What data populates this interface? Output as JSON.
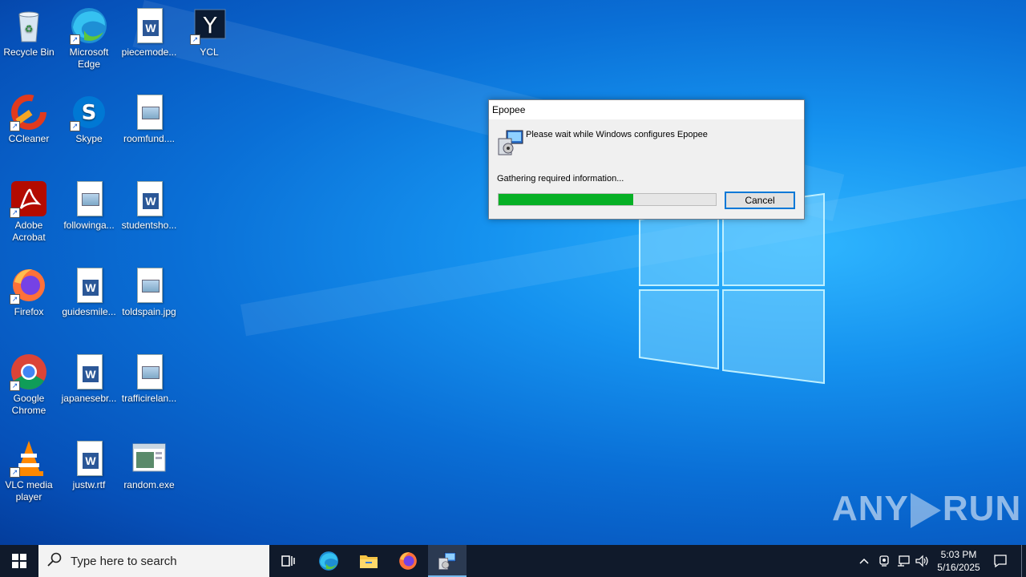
{
  "desktop": {
    "icons": [
      {
        "label": "Recycle Bin",
        "icon": "recycle-bin-icon"
      },
      {
        "label": "Microsoft Edge",
        "icon": "edge-icon"
      },
      {
        "label": "piecemode...",
        "icon": "word-doc-icon"
      },
      {
        "label": "YCL",
        "icon": "ycl-icon"
      },
      {
        "label": "CCleaner",
        "icon": "ccleaner-icon"
      },
      {
        "label": "Skype",
        "icon": "skype-icon"
      },
      {
        "label": "roomfund....",
        "icon": "image-file-icon"
      },
      {
        "label": "Adobe Acrobat",
        "icon": "acrobat-icon"
      },
      {
        "label": "followinga...",
        "icon": "image-file-icon"
      },
      {
        "label": "studentsho...",
        "icon": "word-doc-icon"
      },
      {
        "label": "Firefox",
        "icon": "firefox-icon"
      },
      {
        "label": "guidesmile...",
        "icon": "word-doc-icon"
      },
      {
        "label": "toldspain.jpg",
        "icon": "image-file-icon"
      },
      {
        "label": "Google Chrome",
        "icon": "chrome-icon"
      },
      {
        "label": "japanesebr...",
        "icon": "word-doc-icon"
      },
      {
        "label": "trafficirelan...",
        "icon": "image-file-icon"
      },
      {
        "label": "VLC media player",
        "icon": "vlc-icon"
      },
      {
        "label": "justw.rtf",
        "icon": "word-doc-icon"
      },
      {
        "label": "random.exe",
        "icon": "exe-icon"
      }
    ]
  },
  "dialog": {
    "title": "Epopee",
    "message": "Please wait while Windows configures Epopee",
    "status": "Gathering required information...",
    "progress_fraction": 0.62,
    "cancel_label": "Cancel"
  },
  "watermark": {
    "left": "ANY",
    "right": "RUN"
  },
  "taskbar": {
    "search_placeholder": "Type here to search",
    "time": "5:03 PM",
    "date": "5/16/2025",
    "apps": [
      "task-view-icon",
      "edge-icon",
      "file-explorer-icon",
      "firefox-icon",
      "installer-icon"
    ]
  },
  "colors": {
    "progress_green": "#06b025",
    "taskbar": "#101a2b",
    "accent": "#0078d7"
  }
}
